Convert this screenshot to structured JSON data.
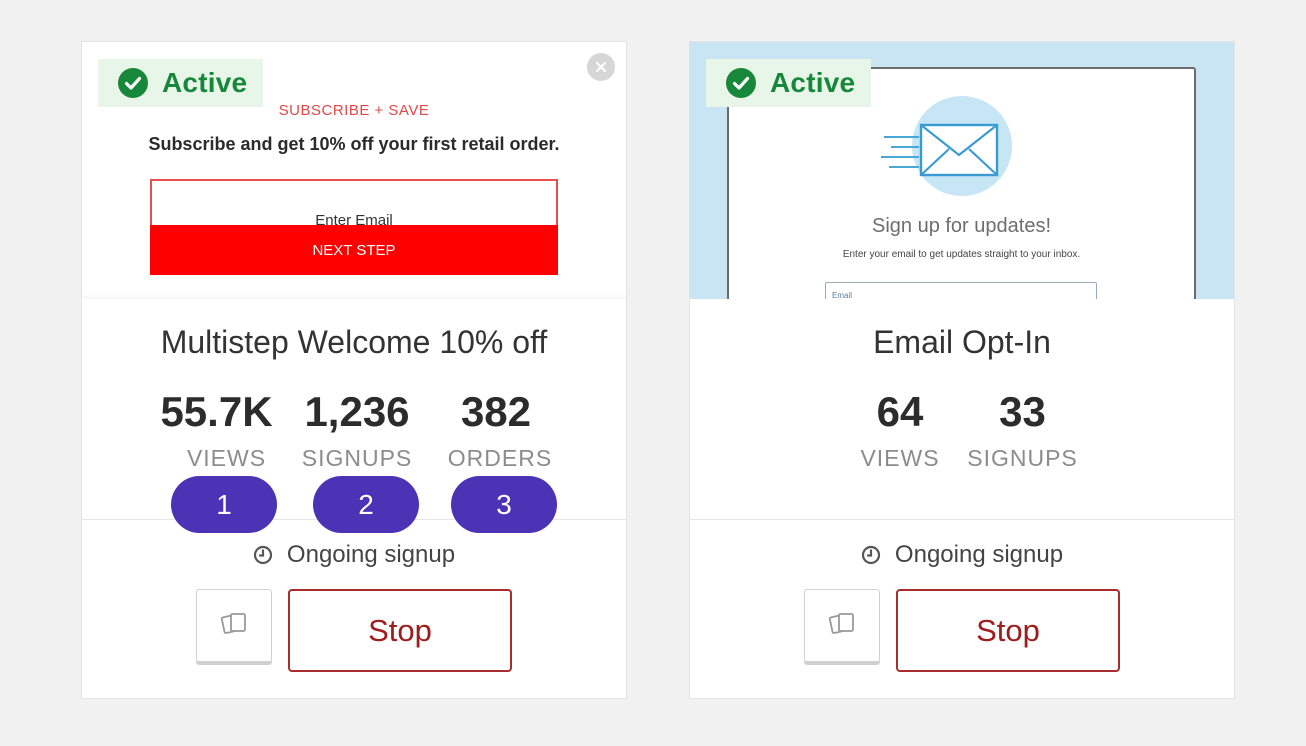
{
  "colors": {
    "active_green": "#17873a",
    "stop_red": "#a01c1c",
    "step_purple": "#4a33b5"
  },
  "cards": [
    {
      "status": "Active",
      "preview": {
        "kicker": "SUBSCRIBE + SAVE",
        "headline": "Subscribe and get 10% off your first retail order.",
        "input_placeholder": "Enter Email",
        "button_label": "NEXT STEP"
      },
      "title": "Multistep Welcome 10% off",
      "stats": [
        {
          "value": "55.7K",
          "label": "VIEWS"
        },
        {
          "value": "1,236",
          "label": "SIGNUPS"
        },
        {
          "value": "382",
          "label": "ORDERS"
        }
      ],
      "steps": [
        "1",
        "2",
        "3"
      ],
      "schedule": "Ongoing signup",
      "stop_label": "Stop"
    },
    {
      "status": "Active",
      "preview": {
        "title": "Sign up for updates!",
        "subtitle": "Enter your email to get updates straight to your inbox.",
        "field_label": "Email"
      },
      "title": "Email Opt-In",
      "stats": [
        {
          "value": "64",
          "label": "VIEWS"
        },
        {
          "value": "33",
          "label": "SIGNUPS"
        }
      ],
      "schedule": "Ongoing signup",
      "stop_label": "Stop"
    }
  ]
}
